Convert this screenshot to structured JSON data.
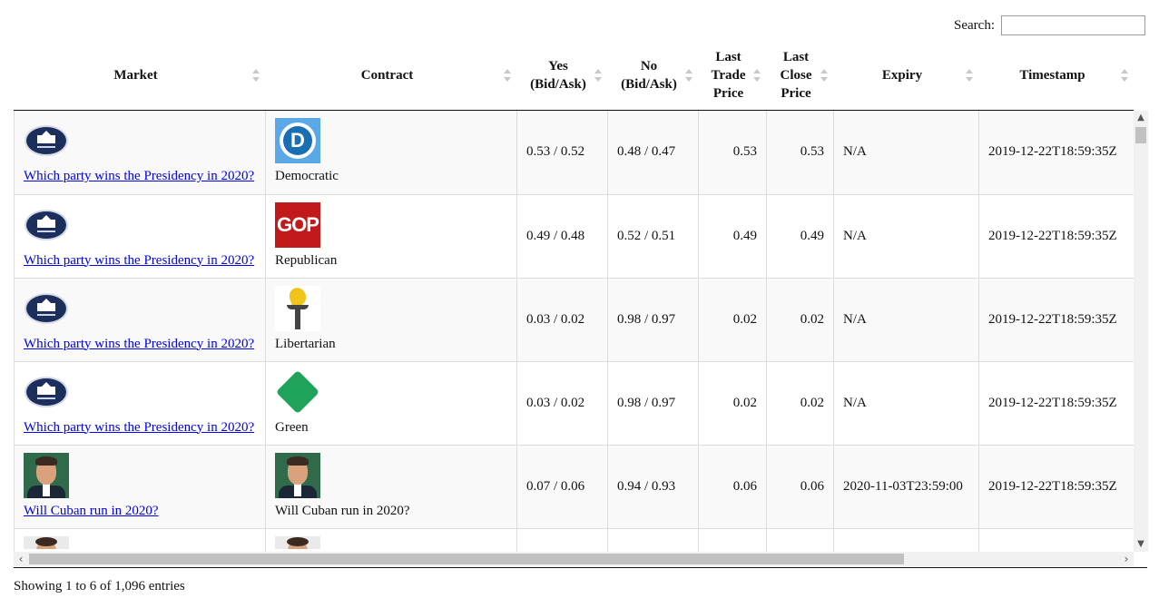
{
  "search": {
    "label": "Search:",
    "value": ""
  },
  "columns": [
    {
      "key": "market",
      "label": "Market"
    },
    {
      "key": "contract",
      "label": "Contract"
    },
    {
      "key": "yes",
      "label": "Yes (Bid/Ask)"
    },
    {
      "key": "no",
      "label": "No (Bid/Ask)"
    },
    {
      "key": "last_trade",
      "label": "Last Trade Price"
    },
    {
      "key": "last_close",
      "label": "Last Close Price"
    },
    {
      "key": "expiry",
      "label": "Expiry"
    },
    {
      "key": "timestamp",
      "label": "Timestamp"
    }
  ],
  "rows": [
    {
      "market_icon": "white-house-seal-icon",
      "market": "Which party wins the Presidency in 2020?",
      "contract_icon": "democratic-logo-icon",
      "contract": "Democratic",
      "yes": "0.53 / 0.52",
      "no": "0.48 / 0.47",
      "last_trade": "0.53",
      "last_close": "0.53",
      "expiry": "N/A",
      "timestamp": "2019-12-22T18:59:35Z"
    },
    {
      "market_icon": "white-house-seal-icon",
      "market": "Which party wins the Presidency in 2020?",
      "contract_icon": "gop-logo-icon",
      "contract": "Republican",
      "yes": "0.49 / 0.48",
      "no": "0.52 / 0.51",
      "last_trade": "0.49",
      "last_close": "0.49",
      "expiry": "N/A",
      "timestamp": "2019-12-22T18:59:35Z"
    },
    {
      "market_icon": "white-house-seal-icon",
      "market": "Which party wins the Presidency in 2020?",
      "contract_icon": "libertarian-torch-icon",
      "contract": "Libertarian",
      "yes": "0.03 / 0.02",
      "no": "0.98 / 0.97",
      "last_trade": "0.02",
      "last_close": "0.02",
      "expiry": "N/A",
      "timestamp": "2019-12-22T18:59:35Z"
    },
    {
      "market_icon": "white-house-seal-icon",
      "market": "Which party wins the Presidency in 2020?",
      "contract_icon": "green-diamond-icon",
      "contract": "Green",
      "yes": "0.03 / 0.02",
      "no": "0.98 / 0.97",
      "last_trade": "0.02",
      "last_close": "0.02",
      "expiry": "N/A",
      "timestamp": "2019-12-22T18:59:35Z"
    },
    {
      "market_icon": "person-photo-icon",
      "market": "Will Cuban run in 2020?",
      "contract_icon": "person-photo-icon",
      "contract": "Will Cuban run in 2020?",
      "yes": "0.07 / 0.06",
      "no": "0.94 / 0.93",
      "last_trade": "0.06",
      "last_close": "0.06",
      "expiry": "2020-11-03T23:59:00",
      "timestamp": "2019-12-22T18:59:35Z"
    }
  ],
  "info": "Showing 1 to 6 of 1,096 entries"
}
